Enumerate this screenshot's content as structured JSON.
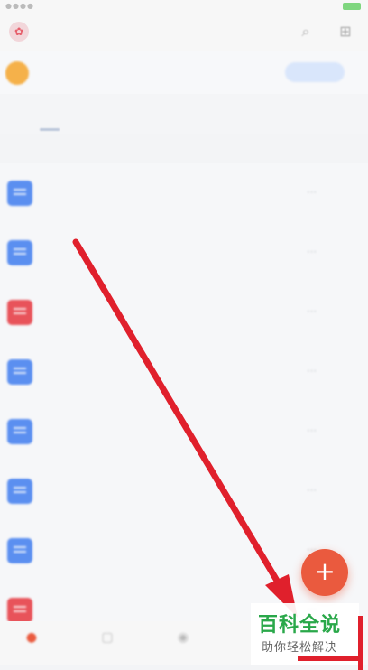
{
  "watermark": {
    "main": "百科全说",
    "sub": "助你轻松解决"
  },
  "fab": {
    "label": "+"
  },
  "colors": {
    "accent": "#ea5a3e",
    "doc_blue": "#5b8ff0",
    "doc_red": "#e8535a",
    "arrow": "#e0202c",
    "watermark_green": "#2aa84a"
  },
  "icons": {
    "header": [
      "search-icon",
      "grid-icon"
    ],
    "nav": [
      "home-icon",
      "docs-icon",
      "app-icon",
      "profile-icon"
    ]
  },
  "list": {
    "rows": [
      {
        "doc_color": "#5b8ff0"
      },
      {
        "doc_color": "#5b8ff0"
      },
      {
        "doc_color": "#e8535a"
      },
      {
        "doc_color": "#5b8ff0"
      },
      {
        "doc_color": "#5b8ff0"
      },
      {
        "doc_color": "#5b8ff0"
      },
      {
        "doc_color": "#5b8ff0"
      },
      {
        "doc_color": "#e8535a"
      }
    ]
  }
}
